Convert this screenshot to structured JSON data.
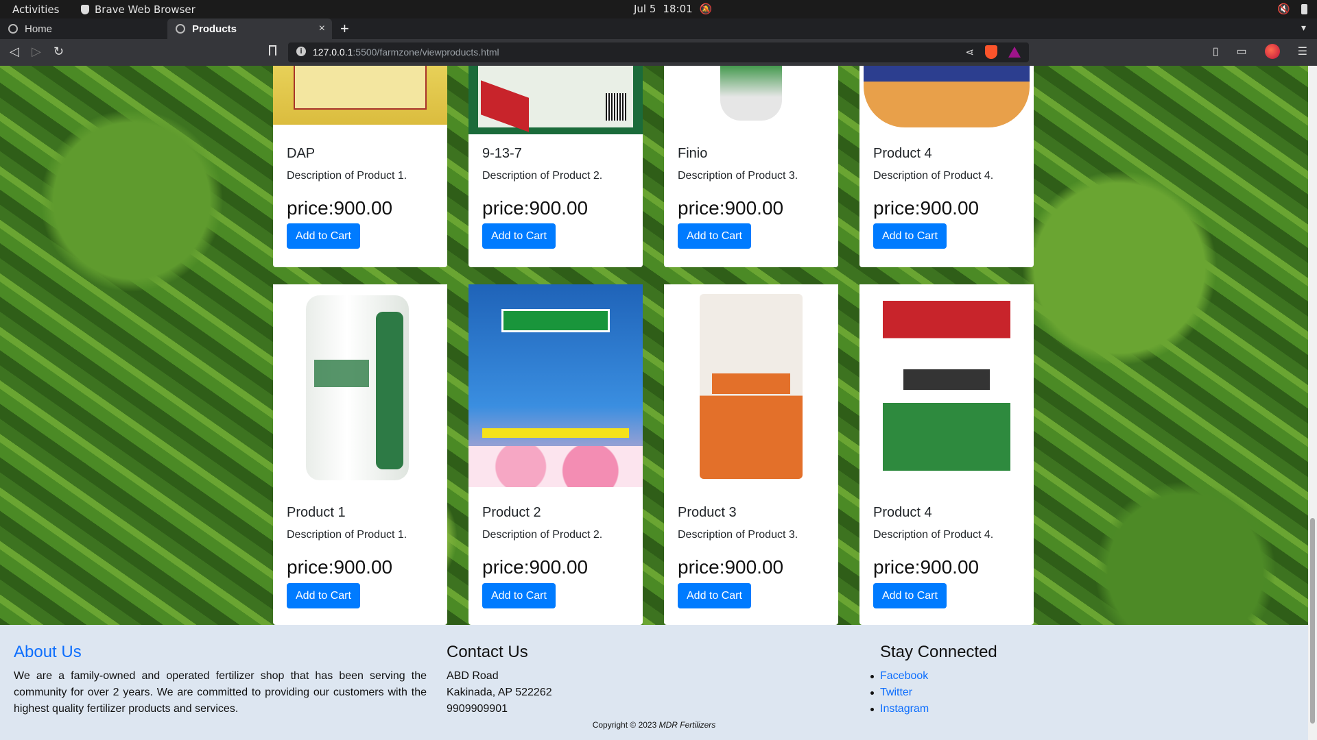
{
  "os": {
    "activities": "Activities",
    "app_name": "Brave Web Browser",
    "date": "Jul 5",
    "time": "18:01"
  },
  "browser": {
    "tabs": [
      {
        "label": "Home"
      },
      {
        "label": "Products",
        "close": "×"
      }
    ],
    "new_tab": "+",
    "url_host": "127.0.0.1",
    "url_path": ":5500/farmzone/viewproducts.html"
  },
  "products_row1": [
    {
      "name": "DAP",
      "description": "Description of Product 1.",
      "price": "price:900.00",
      "button": "Add to Cart"
    },
    {
      "name": "9-13-7",
      "description": "Description of Product 2.",
      "price": "price:900.00",
      "button": "Add to Cart"
    },
    {
      "name": "Finio",
      "description": "Description of Product 3.",
      "price": "price:900.00",
      "button": "Add to Cart"
    },
    {
      "name": "Product 4",
      "description": "Description of Product 4.",
      "price": "price:900.00",
      "button": "Add to Cart"
    }
  ],
  "products_row2": [
    {
      "name": "Product 1",
      "description": "Description of Product 1.",
      "price": "price:900.00",
      "button": "Add to Cart"
    },
    {
      "name": "Product 2",
      "description": "Description of Product 2.",
      "price": "price:900.00",
      "button": "Add to Cart"
    },
    {
      "name": "Product 3",
      "description": "Description of Product 3.",
      "price": "price:900.00",
      "button": "Add to Cart"
    },
    {
      "name": "Product 4",
      "description": "Description of Product 4.",
      "price": "price:900.00",
      "button": "Add to Cart"
    }
  ],
  "footer": {
    "about_title": "About Us",
    "about_text": "We are a family-owned and operated fertilizer shop that has been serving the community for over 2 years. We are committed to providing our customers with the highest quality fertilizer products and services.",
    "contact_title": "Contact Us",
    "contact_lines": [
      "ABD Road",
      "Kakinada, AP 522262",
      "9909909901"
    ],
    "stay_title": "Stay Connected",
    "social": [
      "Facebook",
      "Twitter",
      "Instagram"
    ],
    "copyright_prefix": "Copyright © 2023 ",
    "copyright_brand": "MDR Fertilizers"
  }
}
